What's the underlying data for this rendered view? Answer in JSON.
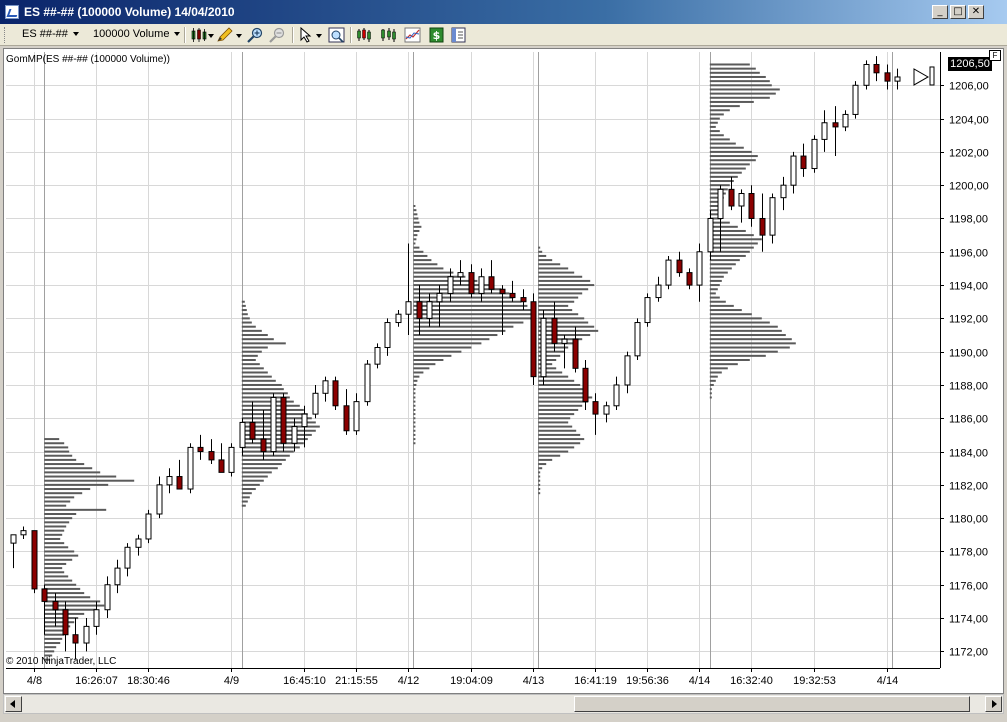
{
  "window": {
    "title": "ES ##-## (100000 Volume)  14/04/2010",
    "controls": {
      "minimize": "_",
      "maximize": "□",
      "close": "✕"
    }
  },
  "toolbar": {
    "instrument": "ES ##-##",
    "period": "100000 Volume",
    "icons": [
      "chart-style-icon",
      "drawing-pencil-icon",
      "zoom-in-icon",
      "zoom-out-icon",
      "pointer-icon",
      "data-box-icon",
      "bar-type-icon",
      "indicators-icon",
      "strategies-icon",
      "properties-icon"
    ]
  },
  "chart": {
    "indicator_label": "GomMP(ES ##-## (100000 Volume))",
    "copyright": "© 2010 NinjaTrader, LLC",
    "last_price": "1206,50",
    "f_button": "F"
  },
  "colors": {
    "up_candle": "#ffffff",
    "down_candle": "#8b0000",
    "profile": "#5a5a5a",
    "grid": "#d8d8d8",
    "session_line": "#a0a0a0"
  },
  "chart_data": {
    "type": "candlestick",
    "y_range": [
      1171,
      1208
    ],
    "y_ticks": [
      "1172,00",
      "1174,00",
      "1176,00",
      "1178,00",
      "1180,00",
      "1182,00",
      "1184,00",
      "1186,00",
      "1188,00",
      "1190,00",
      "1192,00",
      "1194,00",
      "1196,00",
      "1198,00",
      "1200,00",
      "1202,00",
      "1204,00",
      "1206,00"
    ],
    "y_tick_values": [
      1172,
      1174,
      1176,
      1178,
      1180,
      1182,
      1184,
      1186,
      1188,
      1190,
      1192,
      1194,
      1196,
      1198,
      1200,
      1202,
      1204,
      1206
    ],
    "x_labels": [
      {
        "bar": 2,
        "label": "4/8"
      },
      {
        "bar": 8,
        "label": "16:26:07"
      },
      {
        "bar": 13,
        "label": "18:30:46"
      },
      {
        "bar": 21,
        "label": "4/9"
      },
      {
        "bar": 28,
        "label": "16:45:10"
      },
      {
        "bar": 33,
        "label": "21:15:55"
      },
      {
        "bar": 38,
        "label": "4/12"
      },
      {
        "bar": 44,
        "label": "19:04:09"
      },
      {
        "bar": 50,
        "label": "4/13"
      },
      {
        "bar": 56,
        "label": "16:41:19"
      },
      {
        "bar": 61,
        "label": "19:56:36"
      },
      {
        "bar": 66,
        "label": "4/14"
      },
      {
        "bar": 71,
        "label": "16:32:40"
      },
      {
        "bar": 77,
        "label": "19:32:53"
      },
      {
        "bar": 84,
        "label": "4/14"
      }
    ],
    "session_bars": [
      3,
      22,
      38.5,
      50.5,
      67,
      84.5
    ],
    "candles": [
      [
        1178.5,
        1179.0,
        1177.0,
        1179.0
      ],
      [
        1179.0,
        1179.5,
        1178.75,
        1179.25
      ],
      [
        1179.25,
        1179.25,
        1175.5,
        1175.75
      ],
      [
        1175.75,
        1176.0,
        1173.0,
        1175.0
      ],
      [
        1175.0,
        1175.5,
        1173.5,
        1174.5
      ],
      [
        1174.5,
        1175.0,
        1172.0,
        1173.0
      ],
      [
        1173.0,
        1174.0,
        1171.5,
        1172.5
      ],
      [
        1172.5,
        1174.0,
        1172.0,
        1173.5
      ],
      [
        1173.5,
        1175.0,
        1173.0,
        1174.5
      ],
      [
        1174.5,
        1176.5,
        1174.0,
        1176.0
      ],
      [
        1176.0,
        1177.5,
        1175.5,
        1177.0
      ],
      [
        1177.0,
        1178.5,
        1176.5,
        1178.25
      ],
      [
        1178.25,
        1179.0,
        1177.75,
        1178.75
      ],
      [
        1178.75,
        1180.5,
        1178.5,
        1180.25
      ],
      [
        1180.25,
        1182.5,
        1180.0,
        1182.0
      ],
      [
        1182.0,
        1183.0,
        1181.5,
        1182.5
      ],
      [
        1182.5,
        1183.5,
        1182.0,
        1181.75
      ],
      [
        1181.75,
        1184.5,
        1181.5,
        1184.25
      ],
      [
        1184.25,
        1185.0,
        1183.5,
        1184.0
      ],
      [
        1184.0,
        1184.75,
        1183.25,
        1183.5
      ],
      [
        1183.5,
        1184.5,
        1182.75,
        1182.75
      ],
      [
        1182.75,
        1184.5,
        1182.5,
        1184.25
      ],
      [
        1184.25,
        1186.0,
        1183.75,
        1185.75
      ],
      [
        1185.75,
        1187.0,
        1184.5,
        1184.75
      ],
      [
        1184.75,
        1186.5,
        1183.5,
        1184.0
      ],
      [
        1184.0,
        1187.5,
        1183.75,
        1187.25
      ],
      [
        1187.25,
        1187.5,
        1184.0,
        1184.5
      ],
      [
        1184.5,
        1186.0,
        1184.0,
        1185.5
      ],
      [
        1185.5,
        1186.75,
        1184.25,
        1186.25
      ],
      [
        1186.25,
        1188.0,
        1186.0,
        1187.5
      ],
      [
        1187.5,
        1188.5,
        1187.0,
        1188.25
      ],
      [
        1188.25,
        1188.5,
        1186.5,
        1186.75
      ],
      [
        1186.75,
        1187.75,
        1185.0,
        1185.25
      ],
      [
        1185.25,
        1187.5,
        1185.0,
        1187.0
      ],
      [
        1187.0,
        1189.5,
        1186.75,
        1189.25
      ],
      [
        1189.25,
        1190.5,
        1189.0,
        1190.25
      ],
      [
        1190.25,
        1192.0,
        1189.75,
        1191.75
      ],
      [
        1191.75,
        1192.5,
        1191.5,
        1192.25
      ],
      [
        1192.25,
        1196.5,
        1191.0,
        1193.0
      ],
      [
        1193.0,
        1194.0,
        1191.0,
        1192.0
      ],
      [
        1192.0,
        1193.5,
        1191.5,
        1193.0
      ],
      [
        1193.0,
        1194.0,
        1191.5,
        1193.5
      ],
      [
        1193.5,
        1195.0,
        1193.0,
        1194.5
      ],
      [
        1194.5,
        1195.5,
        1194.0,
        1194.75
      ],
      [
        1194.75,
        1195.25,
        1193.25,
        1193.5
      ],
      [
        1193.5,
        1195.0,
        1193.0,
        1194.5
      ],
      [
        1194.5,
        1195.5,
        1193.5,
        1193.75
      ],
      [
        1193.75,
        1194.0,
        1191.0,
        1193.5
      ],
      [
        1193.5,
        1194.25,
        1193.0,
        1193.25
      ],
      [
        1193.25,
        1193.75,
        1192.5,
        1193.0
      ],
      [
        1193.0,
        1193.5,
        1188.0,
        1188.5
      ],
      [
        1188.5,
        1192.5,
        1188.0,
        1192.0
      ],
      [
        1192.0,
        1193.0,
        1190.0,
        1190.5
      ],
      [
        1190.5,
        1191.0,
        1189.0,
        1190.75
      ],
      [
        1190.75,
        1191.5,
        1188.75,
        1189.0
      ],
      [
        1189.0,
        1189.5,
        1186.5,
        1187.0
      ],
      [
        1187.0,
        1187.5,
        1185.0,
        1186.25
      ],
      [
        1186.25,
        1187.0,
        1185.75,
        1186.75
      ],
      [
        1186.75,
        1188.5,
        1186.5,
        1188.0
      ],
      [
        1188.0,
        1190.0,
        1187.5,
        1189.75
      ],
      [
        1189.75,
        1192.0,
        1189.5,
        1191.75
      ],
      [
        1191.75,
        1193.5,
        1191.5,
        1193.25
      ],
      [
        1193.25,
        1194.5,
        1193.0,
        1194.0
      ],
      [
        1194.0,
        1195.75,
        1193.75,
        1195.5
      ],
      [
        1195.5,
        1196.0,
        1194.5,
        1194.75
      ],
      [
        1194.75,
        1195.0,
        1193.75,
        1194.0
      ],
      [
        1194.0,
        1196.5,
        1193.0,
        1196.0
      ],
      [
        1196.0,
        1198.5,
        1195.5,
        1198.0
      ],
      [
        1198.0,
        1200.0,
        1196.0,
        1199.75
      ],
      [
        1199.75,
        1200.5,
        1198.5,
        1198.75
      ],
      [
        1198.75,
        1199.75,
        1197.75,
        1199.5
      ],
      [
        1199.5,
        1200.0,
        1197.5,
        1198.0
      ],
      [
        1198.0,
        1199.5,
        1196.0,
        1197.0
      ],
      [
        1197.0,
        1199.5,
        1196.5,
        1199.25
      ],
      [
        1199.25,
        1200.5,
        1198.5,
        1200.0
      ],
      [
        1200.0,
        1202.0,
        1199.5,
        1201.75
      ],
      [
        1201.75,
        1202.5,
        1200.5,
        1201.0
      ],
      [
        1201.0,
        1203.0,
        1200.75,
        1202.75
      ],
      [
        1202.75,
        1204.5,
        1202.0,
        1203.75
      ],
      [
        1203.75,
        1204.75,
        1201.75,
        1203.5
      ],
      [
        1203.5,
        1204.5,
        1203.25,
        1204.25
      ],
      [
        1204.25,
        1206.25,
        1204.0,
        1206.0
      ],
      [
        1206.0,
        1207.5,
        1205.75,
        1207.25
      ],
      [
        1207.25,
        1207.75,
        1206.25,
        1206.75
      ],
      [
        1206.75,
        1207.25,
        1205.75,
        1206.25
      ],
      [
        1206.25,
        1207.0,
        1205.75,
        1206.5
      ]
    ],
    "profiles": [
      {
        "anchor_bar": 3,
        "top": 1184.75,
        "step": 0.25,
        "lengths": [
          15,
          20,
          24,
          25,
          28,
          32,
          40,
          48,
          56,
          72,
          90,
          64,
          46,
          38,
          30,
          26,
          22,
          62,
          32,
          28,
          25,
          22,
          20,
          18,
          16,
          20,
          24,
          30,
          34,
          28,
          22,
          18,
          20,
          24,
          28,
          32,
          36,
          40,
          46,
          56,
          60,
          52,
          40,
          34,
          30,
          26,
          22,
          20,
          18,
          16,
          12,
          10,
          8,
          6
        ]
      },
      {
        "anchor_bar": 22,
        "top": 1193.0,
        "step": 0.25,
        "lengths": [
          3,
          4,
          5,
          6,
          8,
          10,
          14,
          20,
          26,
          32,
          44,
          26,
          20,
          16,
          14,
          18,
          22,
          26,
          30,
          34,
          40,
          42,
          46,
          48,
          52,
          58,
          62,
          66,
          70,
          74,
          78,
          74,
          70,
          66,
          62,
          58,
          52,
          48,
          44,
          40,
          36,
          30,
          26,
          22,
          18,
          14,
          10,
          8,
          6,
          4
        ]
      },
      {
        "anchor_bar": 38.5,
        "top": 1198.75,
        "step": 0.25,
        "lengths": [
          2,
          3,
          4,
          5,
          6,
          8,
          6,
          4,
          3,
          2,
          6,
          10,
          14,
          18,
          24,
          30,
          40,
          52,
          64,
          76,
          88,
          96,
          100,
          108,
          114,
          118,
          122,
          118,
          110,
          100,
          92,
          84,
          76,
          68,
          58,
          48,
          38,
          30,
          22,
          16,
          10,
          6,
          4,
          3,
          2,
          2,
          2,
          2,
          2,
          2,
          2,
          2,
          2,
          2,
          2,
          2,
          2,
          2
        ]
      },
      {
        "anchor_bar": 50.5,
        "top": 1196.25,
        "step": 0.25,
        "lengths": [
          2,
          4,
          8,
          14,
          22,
          30,
          36,
          44,
          52,
          56,
          50,
          44,
          40,
          36,
          30,
          34,
          40,
          46,
          50,
          56,
          60,
          52,
          44,
          36,
          30,
          26,
          22,
          18,
          14,
          18,
          24,
          30,
          36,
          42,
          46,
          50,
          54,
          50,
          44,
          40,
          36,
          32,
          30,
          34,
          38,
          42,
          46,
          42,
          36,
          30,
          22,
          14,
          8,
          4,
          2,
          2,
          2,
          2,
          2,
          2
        ]
      },
      {
        "anchor_bar": 67,
        "top": 1207.25,
        "step": 0.25,
        "lengths": [
          40,
          46,
          50,
          56,
          60,
          62,
          70,
          66,
          60,
          44,
          30,
          20,
          14,
          10,
          8,
          6,
          10,
          14,
          20,
          26,
          34,
          42,
          48,
          46,
          40,
          36,
          32,
          28,
          24,
          20,
          18,
          16,
          14,
          12,
          10,
          8,
          10,
          12,
          20,
          28,
          36,
          44,
          52,
          48,
          44,
          40,
          36,
          30,
          26,
          22,
          18,
          14,
          12,
          10,
          8,
          6,
          10,
          16,
          24,
          32,
          42,
          52,
          60,
          68,
          72,
          76,
          82,
          86,
          80,
          68,
          56,
          40,
          28,
          18,
          12,
          8,
          6,
          4,
          2,
          2,
          2
        ]
      }
    ]
  }
}
